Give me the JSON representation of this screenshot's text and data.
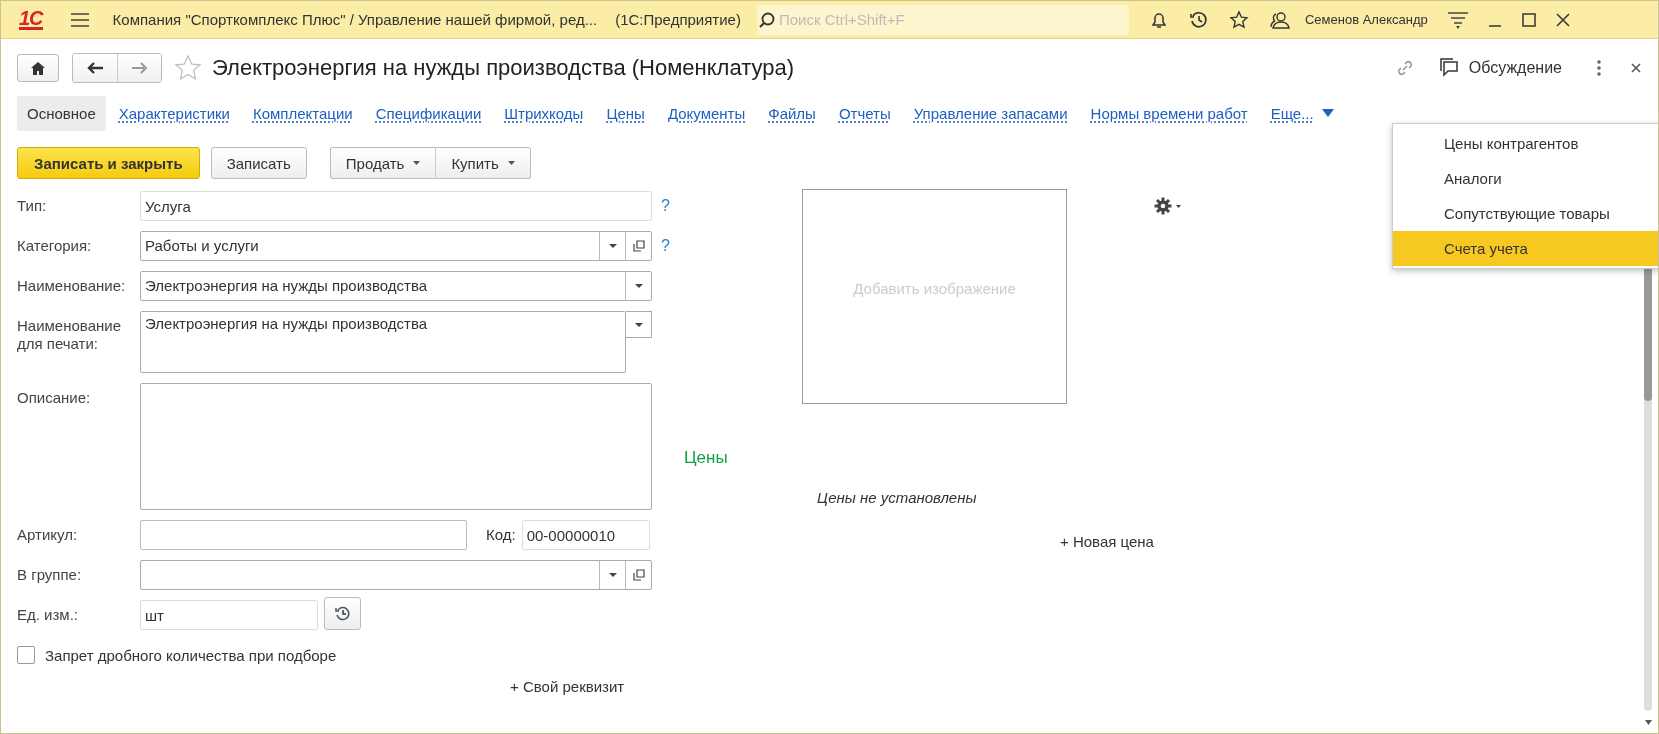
{
  "title_bar": {
    "logo": "1С",
    "company": "Компания \"Спорткомплекс Плюс\" / Управление нашей фирмой, ред...",
    "app": "(1С:Предприятие)",
    "search_placeholder": "Поиск Ctrl+Shift+F",
    "user": "Семенов Александр"
  },
  "form": {
    "title": "Электроэнергия на нужды производства (Номенклатура)",
    "discussion": "Обсуждение"
  },
  "tabs": [
    {
      "label": "Основное",
      "selected": true
    },
    {
      "label": "Характеристики",
      "selected": false
    },
    {
      "label": "Комплектации",
      "selected": false
    },
    {
      "label": "Спецификации",
      "selected": false
    },
    {
      "label": "Штрихкоды",
      "selected": false
    },
    {
      "label": "Цены",
      "selected": false
    },
    {
      "label": "Документы",
      "selected": false
    },
    {
      "label": "Файлы",
      "selected": false
    },
    {
      "label": "Отчеты",
      "selected": false
    },
    {
      "label": "Управление запасами",
      "selected": false
    },
    {
      "label": "Нормы времени работ",
      "selected": false
    }
  ],
  "more": {
    "label": "Еще...",
    "expanded": true
  },
  "more_menu": [
    {
      "label": "Цены контрагентов",
      "selected": false
    },
    {
      "label": "Аналоги",
      "selected": false
    },
    {
      "label": "Сопутствующие товары",
      "selected": false
    },
    {
      "label": "Счета учета",
      "selected": true
    }
  ],
  "buttons": [
    {
      "label": "Записать и закрыть",
      "kind": "primary"
    },
    {
      "label": "Записать",
      "kind": "plain"
    },
    {
      "label": "Продать",
      "kind": "menu"
    },
    {
      "label": "Купить",
      "kind": "menu"
    }
  ],
  "fields": [
    {
      "label": "Тип:",
      "value": "Услуга",
      "kind": "text",
      "help": "?"
    },
    {
      "label": "Категория:",
      "value": "Работы и услуги",
      "kind": "choice",
      "help": "?"
    },
    {
      "label": "Наименование:",
      "value": "Электроэнергия на нужды производства",
      "kind": "dropdown"
    },
    {
      "label": "Наименование для печати:",
      "value": "Электроэнергия на нужды производства",
      "kind": "memo-dropdown"
    },
    {
      "label": "Описание:",
      "kind": "memo"
    },
    {
      "label": "Артикул:",
      "kind": "article",
      "code_label": "Код:",
      "code_value": "00-00000010"
    },
    {
      "label": "В группе:",
      "kind": "choice"
    },
    {
      "label": "Ед. изм.:",
      "value": "шт",
      "kind": "unit"
    }
  ],
  "checkbox": {
    "label": "Запрет дробного количества при подборе",
    "checked": false
  },
  "add_attribute": "+ Свой реквизит",
  "image_placeholder": "Добавить изображение",
  "prices": {
    "title": "Цены",
    "empty": "Цены не установлены",
    "add": "+ Новая цена"
  }
}
